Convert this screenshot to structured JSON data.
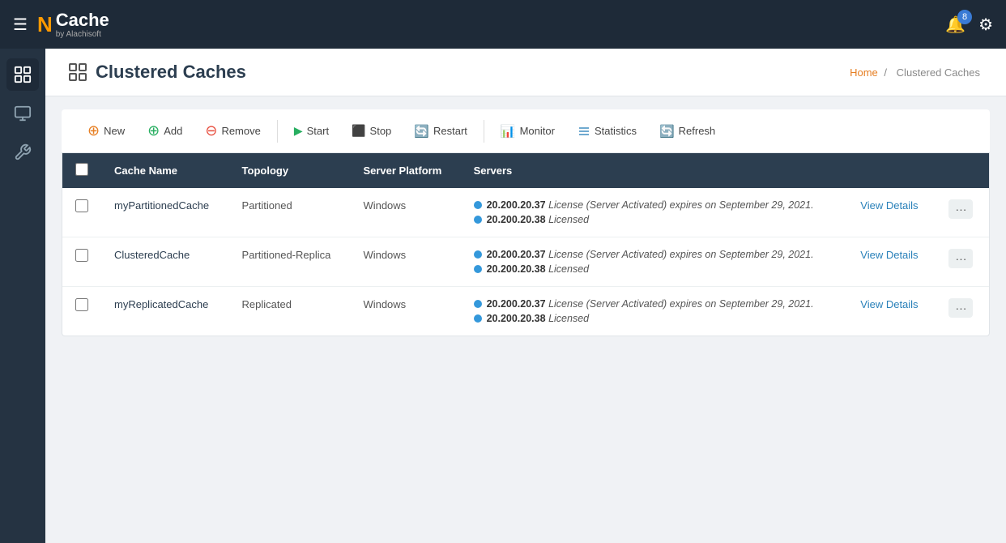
{
  "navbar": {
    "hamburger": "☰",
    "logo": {
      "n": "N",
      "brand": "Cache",
      "tagline": "by Alachisoft"
    },
    "badge_count": "8",
    "bell_icon": "🔔",
    "gear_icon": "⚙"
  },
  "sidebar": {
    "items": [
      {
        "id": "cluster",
        "icon": "⊞",
        "active": true
      },
      {
        "id": "monitor",
        "icon": "🖥",
        "active": false
      },
      {
        "id": "tools",
        "icon": "🔧",
        "active": false
      }
    ]
  },
  "page": {
    "title": "Clustered Caches",
    "title_icon": "⊞",
    "breadcrumb": {
      "home": "Home",
      "separator": "/",
      "current": "Clustered Caches"
    }
  },
  "toolbar": {
    "buttons": [
      {
        "id": "new",
        "label": "New",
        "icon": "➕",
        "color": "orange"
      },
      {
        "id": "add",
        "label": "Add",
        "icon": "➕",
        "color": "green"
      },
      {
        "id": "remove",
        "label": "Remove",
        "icon": "➖",
        "color": "red"
      },
      {
        "id": "start",
        "label": "Start",
        "icon": "▶",
        "color": "green"
      },
      {
        "id": "stop",
        "label": "Stop",
        "icon": "⬛",
        "color": "red"
      },
      {
        "id": "restart",
        "label": "Restart",
        "icon": "🔄",
        "color": "blue"
      },
      {
        "id": "monitor",
        "label": "Monitor",
        "icon": "📊",
        "color": "blue"
      },
      {
        "id": "statistics",
        "label": "Statistics",
        "icon": "☰",
        "color": "blue"
      },
      {
        "id": "refresh",
        "label": "Refresh",
        "icon": "🔄",
        "color": "gray"
      }
    ]
  },
  "table": {
    "headers": [
      "",
      "Cache Name",
      "Topology",
      "Server Platform",
      "Servers",
      "",
      ""
    ],
    "rows": [
      {
        "id": "row1",
        "cache_name": "myPartitionedCache",
        "topology": "Partitioned",
        "server_platform": "Windows",
        "servers": [
          {
            "ip": "20.200.20.37",
            "info": "License (Server Activated) expires on September 29, 2021."
          },
          {
            "ip": "20.200.20.38",
            "info": "Licensed"
          }
        ],
        "view_details": "View Details"
      },
      {
        "id": "row2",
        "cache_name": "ClusteredCache",
        "topology": "Partitioned-Replica",
        "server_platform": "Windows",
        "servers": [
          {
            "ip": "20.200.20.37",
            "info": "License (Server Activated) expires on September 29, 2021."
          },
          {
            "ip": "20.200.20.38",
            "info": "Licensed"
          }
        ],
        "view_details": "View Details"
      },
      {
        "id": "row3",
        "cache_name": "myReplicatedCache",
        "topology": "Replicated",
        "server_platform": "Windows",
        "servers": [
          {
            "ip": "20.200.20.37",
            "info": "License (Server Activated) expires on September 29, 2021."
          },
          {
            "ip": "20.200.20.38",
            "info": "Licensed"
          }
        ],
        "view_details": "View Details"
      }
    ]
  }
}
